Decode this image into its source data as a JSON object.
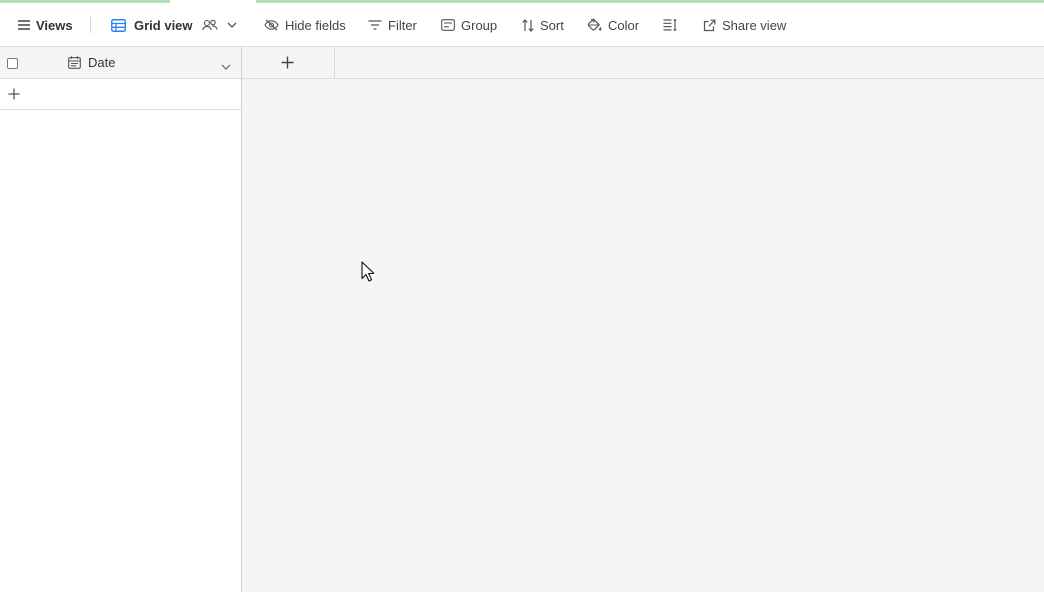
{
  "toolbar": {
    "views_label": "Views",
    "view_name": "Grid view",
    "hide_fields_label": "Hide fields",
    "filter_label": "Filter",
    "group_label": "Group",
    "sort_label": "Sort",
    "color_label": "Color",
    "share_view_label": "Share view",
    "icons": {
      "views": "hamburger-menu-icon",
      "grid": "grid-icon",
      "collaborators": "people-icon",
      "view_menu": "chevron-down-icon",
      "hide_fields": "eye-slash-icon",
      "filter": "filter-icon",
      "group": "group-icon",
      "sort": "sort-icon",
      "color": "paint-bucket-icon",
      "row_height": "row-height-icon",
      "share_view": "external-link-icon"
    }
  },
  "grid": {
    "primary_field": {
      "name": "Date",
      "icon": "calendar-icon",
      "menu_icon": "chevron-down-icon"
    },
    "add_row_icon": "plus-icon",
    "add_field_icon": "plus-icon",
    "select_all_checked": false
  },
  "colors": {
    "accent_top": "#b6dfb9",
    "grid_icon_blue": "#2d7ff9",
    "canvas_bg": "#f5f5f5",
    "border": "#dddddd"
  }
}
